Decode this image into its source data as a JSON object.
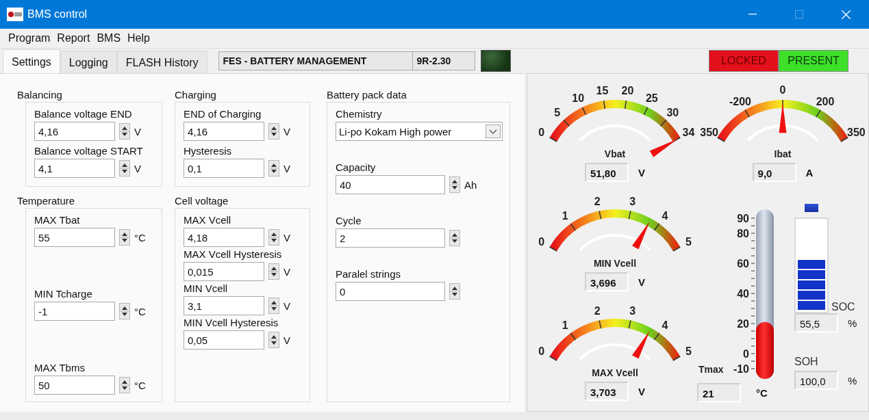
{
  "window": {
    "title": "BMS control"
  },
  "menu": [
    "Program",
    "Report",
    "BMS",
    "Help"
  ],
  "tabs": [
    {
      "label": "Settings",
      "selected": true
    },
    {
      "label": "Logging",
      "selected": false
    },
    {
      "label": "FLASH History",
      "selected": false
    }
  ],
  "header": {
    "name": "FES - BATTERY MANAGEMENT",
    "version": "9R-2.30",
    "led_on": false
  },
  "indicators": [
    {
      "label": "LOCKED",
      "color": "#e4101c"
    },
    {
      "label": "PRESENT",
      "color": "#3ee02a"
    }
  ],
  "columns": [
    {
      "groups": [
        {
          "title": "Balancing",
          "fields": [
            {
              "kind": "spin",
              "label": "Balance voltage END",
              "value": "4,16",
              "unit": "V"
            },
            {
              "kind": "spin",
              "label": "Balance voltage START",
              "value": "4,1",
              "unit": "V"
            }
          ]
        },
        {
          "title": "Temperature",
          "fields": [
            {
              "kind": "spin",
              "label": "MAX Tbat",
              "value": "55",
              "unit": "°C"
            },
            {
              "kind": "spin",
              "label": "MIN Tcharge",
              "value": "-1",
              "unit": "°C"
            },
            {
              "kind": "spin",
              "label": "MAX Tbms",
              "value": "50",
              "unit": "°C"
            }
          ]
        }
      ]
    },
    {
      "groups": [
        {
          "title": "Charging",
          "fields": [
            {
              "kind": "spin",
              "label": "END of Charging",
              "value": "4,16",
              "unit": "V"
            },
            {
              "kind": "spin",
              "label": "Hysteresis",
              "value": "0,1",
              "unit": "V"
            }
          ]
        },
        {
          "title": "Cell voltage",
          "fields": [
            {
              "kind": "spin",
              "label": "MAX Vcell",
              "value": "4,18",
              "unit": "V"
            },
            {
              "kind": "spin",
              "label": "MAX Vcell Hysteresis",
              "value": "0,015",
              "unit": "V"
            },
            {
              "kind": "spin",
              "label": "MIN Vcell",
              "value": "3,1",
              "unit": "V"
            },
            {
              "kind": "spin",
              "label": "MIN Vcell Hysteresis",
              "value": "0,05",
              "unit": "V"
            }
          ]
        }
      ]
    },
    {
      "groups": [
        {
          "title": "Battery pack data",
          "fields": [
            {
              "kind": "dropdown",
              "label": "Chemistry",
              "value": "Li-po Kokam High power"
            },
            {
              "kind": "spin",
              "label": "Capacity",
              "value": "40",
              "unit": "Ah"
            },
            {
              "kind": "spin",
              "label": "Cycle",
              "value": "2"
            },
            {
              "kind": "spin",
              "label": "Paralel strings",
              "value": "0"
            }
          ]
        }
      ]
    }
  ],
  "gauges": [
    {
      "title": "Vbat",
      "ticks": [
        "0",
        "5",
        "10",
        "15",
        "20",
        "25",
        "30",
        "34"
      ],
      "value": "51,80",
      "unit": "V"
    },
    {
      "title": "Ibat",
      "ticks": [
        "350",
        "-200",
        "0",
        "200",
        "350"
      ],
      "value": "9,0",
      "unit": "A"
    },
    {
      "title": "MIN Vcell",
      "ticks": [
        "0",
        "1",
        "2",
        "3",
        "4",
        "5"
      ],
      "value": "3,696",
      "unit": "V"
    },
    {
      "title": "MAX Vcell",
      "ticks": [
        "0",
        "1",
        "2",
        "3",
        "4",
        "5"
      ],
      "value": "3,703",
      "unit": "V"
    }
  ],
  "thermometer": {
    "title": "Tmax",
    "ticks": [
      "90",
      "80",
      "60",
      "40",
      "20",
      "0",
      "-10"
    ],
    "level": 0.31,
    "value": "21",
    "unit": "°C"
  },
  "soc": {
    "label": "SOC",
    "level": 0.555,
    "value": "55,5",
    "unit": "%"
  },
  "soh": {
    "label": "SOH",
    "value": "100,0",
    "unit": "%"
  }
}
